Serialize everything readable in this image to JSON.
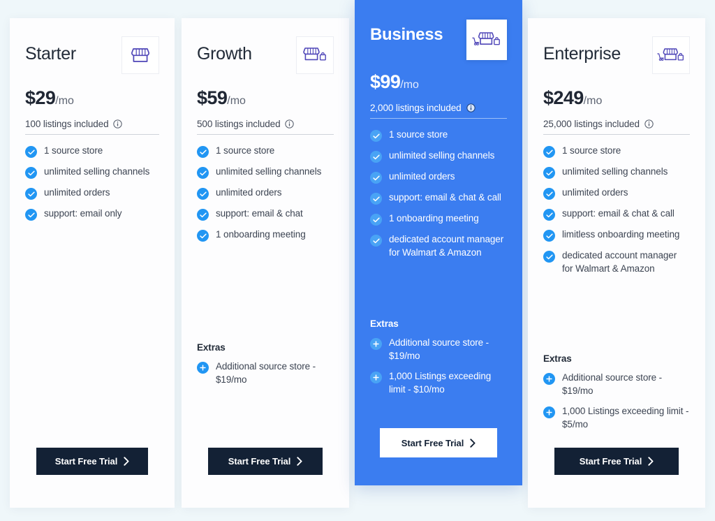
{
  "page": {
    "background_color": "#eff7fa",
    "accent_blue": "#2196f3",
    "featured_blue": "#3b7df0",
    "cta_dark": "#132135",
    "icon_purple": "#4f46b8"
  },
  "cta": {
    "label": "Start Free Trial",
    "chevron_icon": "chevron-right-icon"
  },
  "labels": {
    "extras_title": "Extras",
    "info_icon": "info-icon",
    "check_icon": "check-circle-icon",
    "plus_icon": "plus-circle-icon",
    "store_icon": "storefront-icon"
  },
  "plans": [
    {
      "id": "starter",
      "name": "Starter",
      "price_amount": "$29",
      "price_period": "/mo",
      "listings": "100 listings included",
      "featured": false,
      "icon": "storefront-icon",
      "features": [
        "1 source store",
        "unlimited selling channels",
        "unlimited orders",
        "support: email only"
      ],
      "extras_title": "Extras",
      "extras": []
    },
    {
      "id": "growth",
      "name": "Growth",
      "price_amount": "$59",
      "price_period": "/mo",
      "listings": "500 listings included",
      "featured": false,
      "icon": "storefront-bag-icon",
      "features": [
        "1 source store",
        "unlimited selling channels",
        "unlimited orders",
        "support: email & chat",
        "1 onboarding meeting"
      ],
      "extras_title": "Extras",
      "extras": [
        "Additional source store - $19/mo"
      ]
    },
    {
      "id": "business",
      "name": "Business",
      "price_amount": "$99",
      "price_period": "/mo",
      "listings": "2,000 listings included",
      "featured": true,
      "icon": "storefront-cart-bag-icon",
      "features": [
        "1 source store",
        "unlimited selling channels",
        "unlimited orders",
        "support: email & chat & call",
        "1 onboarding meeting",
        "dedicated account manager for Walmart & Amazon"
      ],
      "extras_title": "Extras",
      "extras": [
        "Additional source store - $19/mo",
        "1,000 Listings exceeding limit - $10/mo"
      ]
    },
    {
      "id": "enterprise",
      "name": "Enterprise",
      "price_amount": "$249",
      "price_period": "/mo",
      "listings": "25,000 listings included",
      "featured": false,
      "icon": "storefront-cart-bag-icon",
      "features": [
        "1 source store",
        "unlimited selling channels",
        "unlimited orders",
        "support: email & chat & call",
        "limitless onboarding meeting",
        "dedicated account manager for Walmart & Amazon"
      ],
      "extras_title": "Extras",
      "extras": [
        "Additional source store - $19/mo",
        "1,000 Listings exceeding limit - $5/mo"
      ]
    }
  ]
}
